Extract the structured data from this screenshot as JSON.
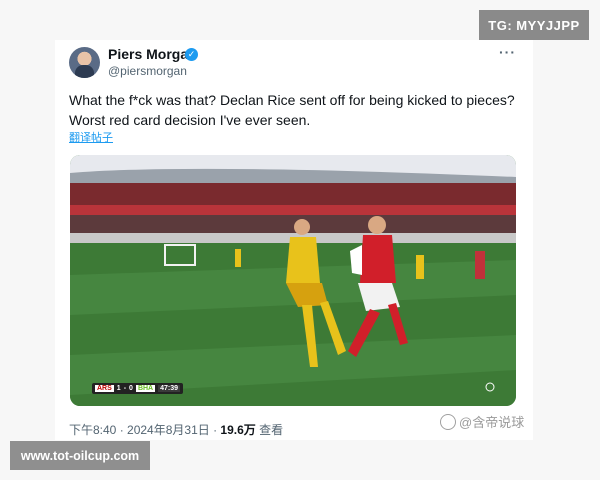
{
  "watermarks": {
    "top": "TG: MYYJJPP",
    "bottom": "www.tot-oilcup.com"
  },
  "tweet": {
    "author_name": "Piers Morgan",
    "author_handle": "@piersmorgan",
    "text_line1": "What the f*ck was that? Declan Rice sent off for being kicked to pieces?",
    "text_line2": "Worst red card decision I've ever seen.",
    "translate_link": "翻译帖子",
    "more_icon": "more-icon",
    "verified_icon": "verified-badge-icon",
    "time": "下午8:40 · 2024年8月31日 · ",
    "views_count": "19.6万",
    "views_label": " 查看"
  },
  "media": {
    "description_icon": "football-match-photo",
    "score_bug": {
      "home": "ARS",
      "home_score": "1",
      "away_score": "0",
      "away": "BHA",
      "clock": "47:39"
    }
  },
  "source_mark": {
    "text": "@含帝说球",
    "icon": "profile-icon"
  },
  "colors": {
    "accent": "#1d9bf0",
    "text_primary": "#0f1419",
    "text_secondary": "#536471",
    "pitch": "#3f7c3a",
    "arsenal_red": "#d11f2a",
    "brighton_yellow": "#e8c21b"
  }
}
